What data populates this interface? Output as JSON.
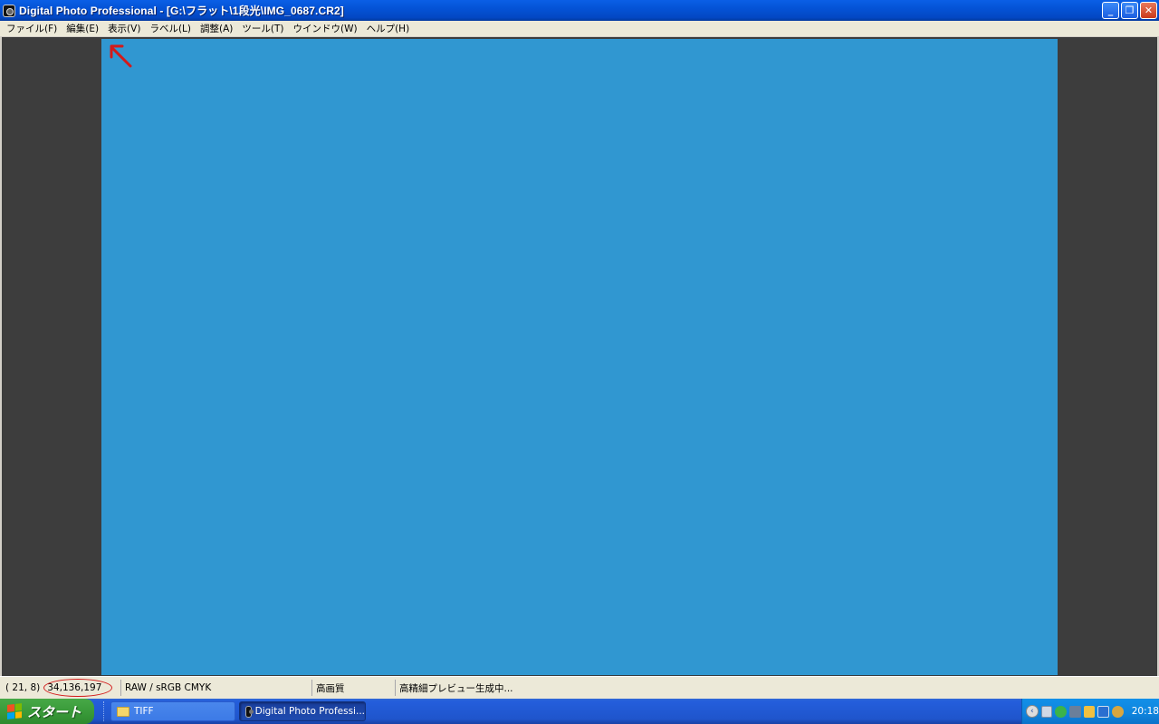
{
  "window": {
    "title": "Digital Photo Professional - [G:\\フラット\\1段光\\IMG_0687.CR2]",
    "controls": {
      "minimize": "_",
      "restore": "❐",
      "close": "✕"
    }
  },
  "menu": {
    "items": [
      {
        "label": "ファイル(F)"
      },
      {
        "label": "編集(E)"
      },
      {
        "label": "表示(V)"
      },
      {
        "label": "ラベル(L)"
      },
      {
        "label": "調整(A)"
      },
      {
        "label": "ツール(T)"
      },
      {
        "label": "ウインドウ(W)"
      },
      {
        "label": "ヘルプ(H)"
      }
    ]
  },
  "image": {
    "color": "#3097d1"
  },
  "annotation": {
    "color": "#d31a1a"
  },
  "status": {
    "coords": "( 21,  8)",
    "value": "34,136,197",
    "mode": "RAW / sRGB  CMYK",
    "quality": "高画質",
    "message": "高精細プレビュー生成中..."
  },
  "taskbar": {
    "start_label": "スタート",
    "tasks": [
      {
        "label": "TIFF"
      },
      {
        "label": "Digital Photo Professi..."
      }
    ],
    "clock": "20:18",
    "tray_arrow": "‹"
  }
}
